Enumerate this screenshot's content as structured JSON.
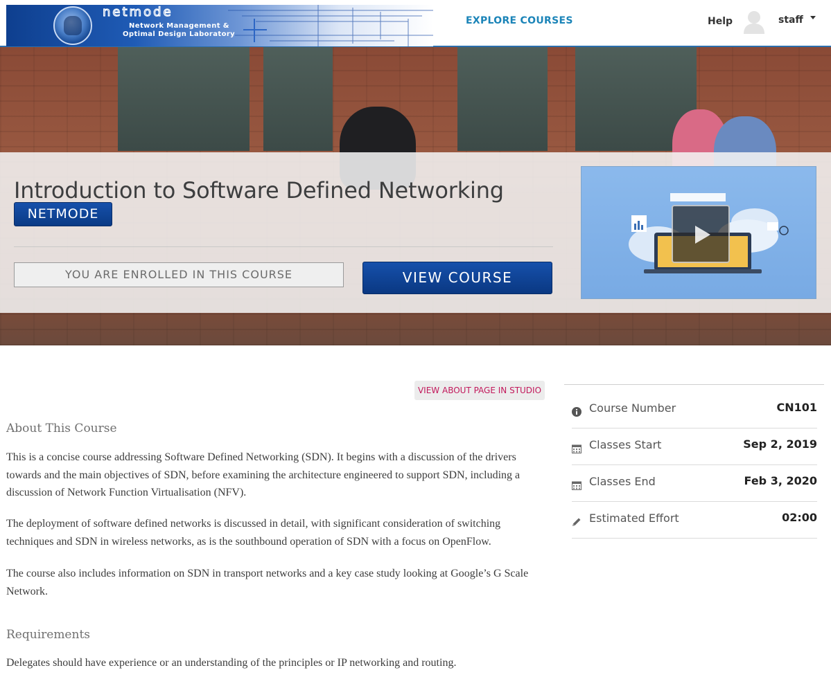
{
  "header": {
    "logo": {
      "wordmark": "netmode",
      "subtitle_line1": "Network Management &",
      "subtitle_line2": "Optimal Design Laboratory"
    },
    "nav": {
      "explore_courses": "EXPLORE COURSES",
      "help": "Help",
      "username": "staff"
    }
  },
  "hero": {
    "course_title": "Introduction to Software Defined Networking",
    "organization": "NETMODE",
    "enrolled_message": "YOU ARE ENROLLED IN THIS COURSE",
    "view_course_label": "VIEW COURSE"
  },
  "main": {
    "studio_link": "VIEW ABOUT PAGE IN STUDIO",
    "about_heading": "About This Course",
    "about_paragraphs": [
      "This is a concise course addressing Software Defined Networking (SDN). It begins with a discussion of the drivers towards and the main objectives of SDN, before examining the architecture engineered to support SDN, including a discussion of Network Function Virtualisation (NFV).",
      "The deployment of software defined networks is discussed in detail, with significant consideration of switching techniques and SDN in wireless networks, as is the southbound operation of SDN with a focus on OpenFlow.",
      "The course also includes information on SDN in transport networks and a key case study looking at Google’s G Scale Network."
    ],
    "requirements_heading": "Requirements",
    "requirements_text": "Delegates should have experience or an understanding of the principles or IP networking and routing."
  },
  "sidebar": {
    "items": [
      {
        "icon": "info-icon",
        "label": "Course Number",
        "value": "CN101"
      },
      {
        "icon": "calendar-icon",
        "label": "Classes Start",
        "value": "Sep 2, 2019"
      },
      {
        "icon": "calendar-icon",
        "label": "Classes End",
        "value": "Feb 3, 2020"
      },
      {
        "icon": "pencil-icon",
        "label": "Estimated Effort",
        "value": "02:00"
      }
    ]
  },
  "colors": {
    "accent_link": "#1b84b8",
    "brand_blue": "#0a3a85",
    "studio_link": "#c2185b"
  }
}
